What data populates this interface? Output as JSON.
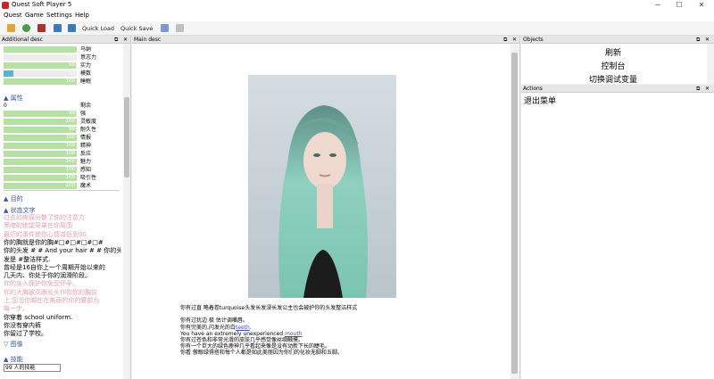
{
  "app": {
    "title": "Quest Soft Player 5"
  },
  "menu": [
    "Quest",
    "Game",
    "Settings",
    "Help"
  ],
  "toolbar": {
    "quick_load": "Quick Load",
    "quick_save": "Quick Save"
  },
  "left_panel": {
    "header": "Additional desc",
    "top_stats": [
      {
        "value": "",
        "label": "马纳",
        "fill": 1.0,
        "color": "green"
      },
      {
        "value": "133",
        "label": "意志力",
        "fill": 0.0,
        "color": "green"
      },
      {
        "value": "99",
        "label": "实力",
        "fill": 0.99,
        "color": "green"
      },
      {
        "value": "13",
        "label": "模数",
        "fill": 0.13,
        "color": "blue"
      },
      {
        "value": "100",
        "label": "睡眠",
        "fill": 1.0,
        "color": "green"
      }
    ],
    "attr_link": "▲ 属性",
    "attr_remaining": {
      "value": "0",
      "label": "剩余"
    },
    "attributes": [
      {
        "value": "99",
        "label": "强",
        "fill": 0.99
      },
      {
        "value": "100",
        "label": "灵敏度",
        "fill": 1.0
      },
      {
        "value": "99",
        "label": "耐久性",
        "fill": 0.99
      },
      {
        "value": "100",
        "label": "情报",
        "fill": 1.0
      },
      {
        "value": "100",
        "label": "精神",
        "fill": 1.0
      },
      {
        "value": "100",
        "label": "反应",
        "fill": 1.0
      },
      {
        "value": "100",
        "label": "魅力",
        "fill": 1.0
      },
      {
        "value": "100",
        "label": "感知",
        "fill": 1.0
      },
      {
        "value": "100",
        "label": "吸引性",
        "fill": 1.0
      },
      {
        "value": "100",
        "label": "魔术",
        "fill": 1.0
      }
    ],
    "goals_link": "▲ 目的",
    "status_link": "▲ 状态文字",
    "status_lines": [
      {
        "text": "过去的疼痛分散了你的注意力",
        "pink": true
      },
      {
        "text": "黑暗的绝望笼罩在你周围",
        "pink": true
      },
      {
        "text": "最近的事件使你心情减低到90",
        "pink": true
      },
      {
        "text": "你的胸就是你的胸#□#□#□#□#",
        "pink": false
      },
      {
        "text": "你的头发 # # And your hair # # 你的头",
        "pink": false
      },
      {
        "text": "发是 #整洁样式.",
        "pink": false
      },
      {
        "text": "曾经是16自你上一个周期开始以来的",
        "pink": false
      },
      {
        "text": "几天内、你处于你的润滑阶段。",
        "pink": false
      },
      {
        "text": "你的身入保护你免受怀孕。",
        "pink": true
      },
      {
        "text": "你的大胸被高跟长头作你你的胸前",
        "pink": true
      },
      {
        "text": "上,您当你脚在在美丽的你的腰部为",
        "pink": true
      },
      {
        "text": "每一步。",
        "pink": true
      },
      {
        "text": "你穿着   school uniform.",
        "pink": false
      },
      {
        "text": "你没有穿内裤",
        "pink": false
      },
      {
        "text": "你留过了学校。",
        "pink": false
      }
    ],
    "image_link": "▽ 图像",
    "skills_link": "▲ 技能",
    "skill_entry": "99 人的技能"
  },
  "main_panel": {
    "header": "Main desc",
    "story": [
      {
        "pre": "你有过直 略着卷turquoise头发长发浸长发公主也会被护你的头发整洁样式",
        "link": "",
        "post": ""
      },
      {
        "pre": "",
        "link": "",
        "post": ""
      },
      {
        "pre": "你有过犹边 极 估计调嘴唇。",
        "link": "",
        "post": ""
      },
      {
        "pre": "你有完美的,闪发光的白",
        "link": "teeth",
        "post": "."
      },
      {
        "pre": "You have an extremely unexperienced ",
        "link": "mouth",
        "post": ""
      },
      {
        "pre": "你有过苍色和非常光滑的皮肤几乎感觉像丝绸触摸。",
        "link": "",
        "post": ""
      },
      {
        "pre": "你有一个巨大的绿色鹿神几乎看起来像是没有动新下长的睫毛。",
        "link": "",
        "post": ""
      },
      {
        "pre": "你看 傲眼绿得搭和每个人都是如此美丽因为你们的化妆无脚和五脚。",
        "link": "",
        "post": ""
      }
    ]
  },
  "objects_panel": {
    "header": "Objects",
    "items": [
      "刷新",
      "控制台",
      "切换调试变量"
    ]
  },
  "actions_panel": {
    "header": "Actions",
    "items": [
      "退出菜单"
    ]
  },
  "colors": {
    "bar_green": "#b6e0a4",
    "bar_blue": "#5ab4cf",
    "link": "#3a54a8",
    "pink_text": "#e8a0b0",
    "app_icon": "#c8262a"
  }
}
